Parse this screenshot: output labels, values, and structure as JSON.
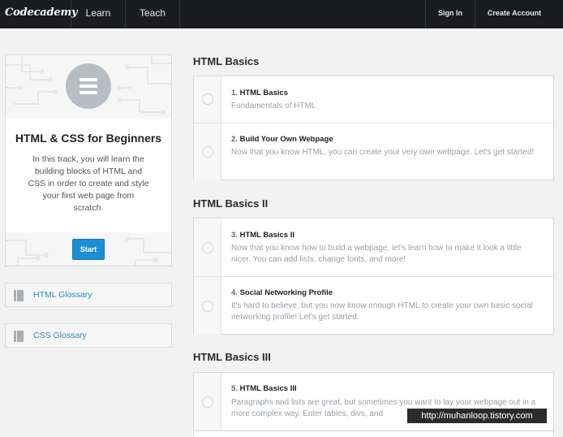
{
  "topbar": {
    "logo": "Codecademy",
    "learn": "Learn",
    "teach": "Teach",
    "sign_in": "Sign In",
    "create_account": "Create Account"
  },
  "sidebar": {
    "track_title": "HTML & CSS for Beginners",
    "track_description": "In this track, you will learn the building blocks of HTML and CSS in order to create and style your first web page from scratch.",
    "start_label": "Start",
    "glossaries": [
      "HTML Glossary",
      "CSS Glossary"
    ]
  },
  "sections": [
    {
      "title": "HTML Basics",
      "lessons": [
        {
          "number": "1.",
          "title": "HTML Basics",
          "description": "Fundamentals of HTML"
        },
        {
          "number": "2.",
          "title": "Build Your Own Webpage",
          "description": "Now that you know HTML, you can create your very own webpage. Let's get started!"
        }
      ]
    },
    {
      "title": "HTML Basics II",
      "lessons": [
        {
          "number": "3.",
          "title": "HTML Basics II",
          "description": "Now that you know how to build a webpage, let's learn how to make it look a little nicer. You can add lists, change fonts, and more!"
        },
        {
          "number": "4.",
          "title": "Social Networking Profile",
          "description": "It's hard to believe, but you now know enough HTML to create your own basic social networking profile! Let's get started."
        }
      ]
    },
    {
      "title": "HTML Basics III",
      "lessons": [
        {
          "number": "5.",
          "title": "HTML Basics III",
          "description": "Paragraphs and lists are great, but sometimes you want to lay your webpage out in a more complex way. Enter tables, divs, and"
        }
      ]
    }
  ],
  "watermark": "http://muhanloop.tistory.com",
  "colors": {
    "topbar": "#1a1c1f",
    "accent_blue": "#1b8fd6",
    "link_blue": "#2a8bc9",
    "background": "#f2f2f2"
  },
  "icons": {
    "track": "list-menu-icon",
    "glossary": "document-icon",
    "lesson": "radio-circle-icon"
  }
}
